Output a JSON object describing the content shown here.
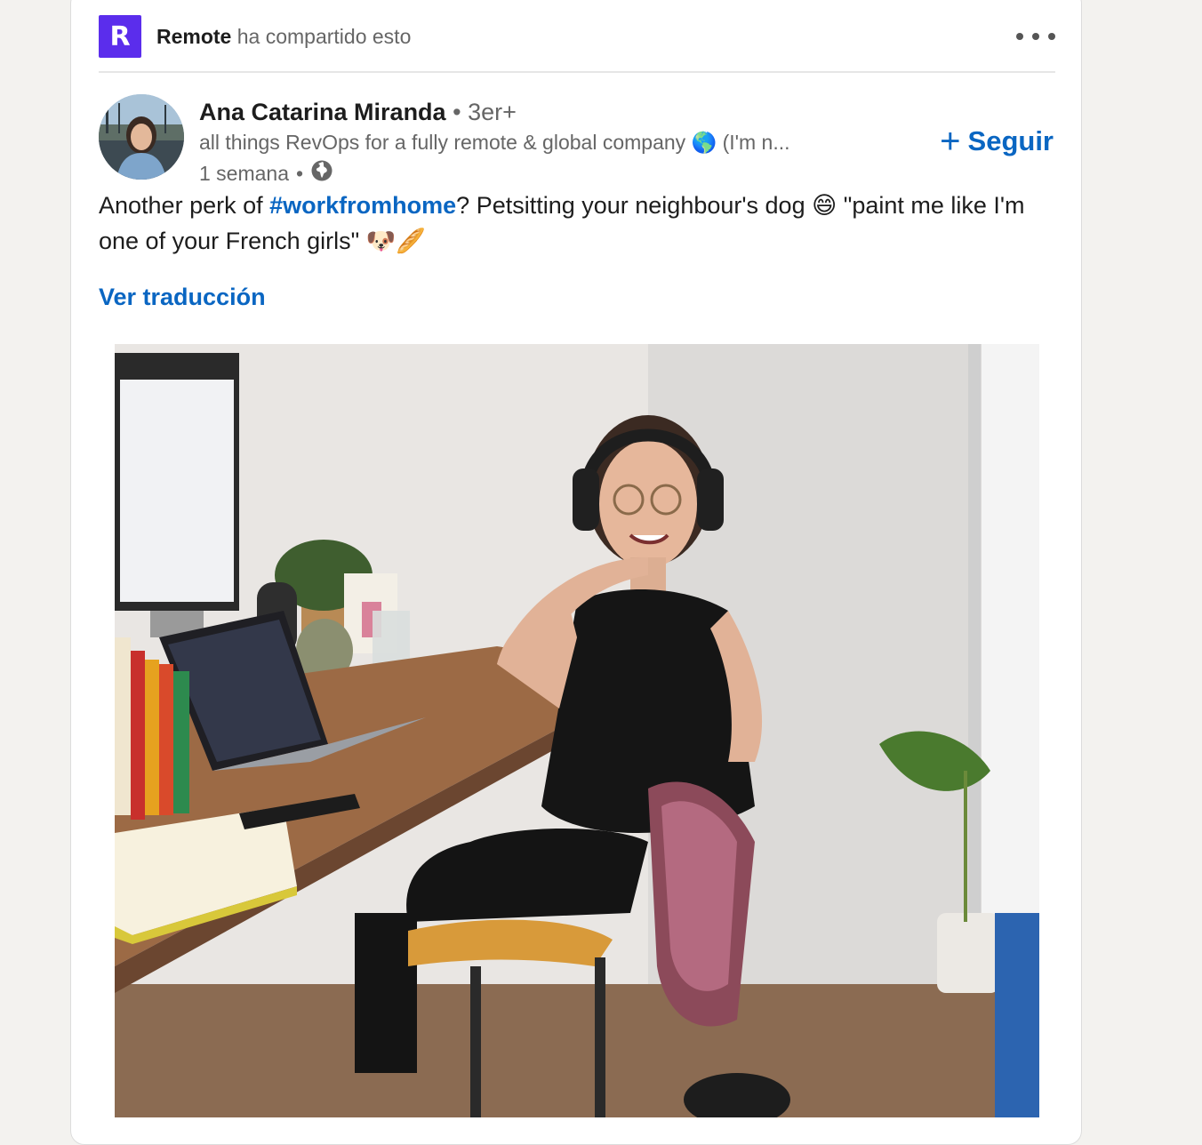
{
  "shared_header": {
    "logo_letter": "R",
    "company": "Remote",
    "shared_text": "ha compartido esto"
  },
  "author": {
    "name": "Ana Catarina Miranda",
    "degree": "3er+",
    "headline": "all things RevOps for a fully remote & global company 🌎 (I'm n...",
    "time": "1 semana",
    "visibility_icon": "globe-icon"
  },
  "follow": {
    "label": "Seguir"
  },
  "post": {
    "text_before": "Another perk of ",
    "hashtag": "#workfromhome",
    "text_after": "? Petsitting your neighbour's dog 😄  \"paint me like I'm one of your French girls\" 🐶🥖",
    "translate_label": "Ver traducción"
  },
  "colors": {
    "link": "#0a66c2",
    "remote_brand": "#5b2dec",
    "background": "#f3f2ef"
  }
}
